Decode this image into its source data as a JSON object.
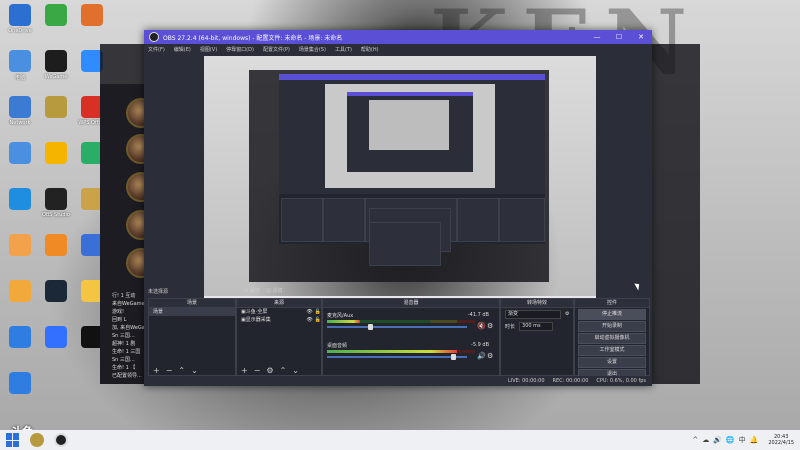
{
  "desktop": {
    "icons": [
      {
        "label": "OneDrive",
        "icon": "onedrive-icon",
        "color": "#2b6fd1"
      },
      {
        "label": "",
        "icon": "browser-icon",
        "color": "#3aa845"
      },
      {
        "label": "",
        "icon": "app-icon",
        "color": "#e2702d"
      },
      {
        "label": "电脑",
        "icon": "computer-icon",
        "color": "#4b8fe0"
      },
      {
        "label": "WeGame",
        "icon": "wegame-icon",
        "color": "#1d1d1d"
      },
      {
        "label": "",
        "icon": "baidu-netdisk-icon",
        "color": "#2f8cff"
      },
      {
        "label": "Network",
        "icon": "network-icon",
        "color": "#3b7bd4"
      },
      {
        "label": "",
        "icon": "lol-icon",
        "color": "#b89a3e"
      },
      {
        "label": "WPS Office",
        "icon": "wps-icon",
        "color": "#d93025"
      },
      {
        "label": "",
        "icon": "control-panel-icon",
        "color": "#4b8fe0"
      },
      {
        "label": "",
        "icon": "qq-music-icon",
        "color": "#f4b400"
      },
      {
        "label": "",
        "icon": "wechat-icon",
        "color": "#2aae67"
      },
      {
        "label": "",
        "icon": "edge-icon",
        "color": "#1f8de0"
      },
      {
        "label": "OBS Studio",
        "icon": "obs-icon",
        "color": "#222222"
      },
      {
        "label": "",
        "icon": "game-icon",
        "color": "#caa24a"
      },
      {
        "label": "",
        "icon": "downloader-icon",
        "color": "#f1a24a"
      },
      {
        "label": "",
        "icon": "edit-icon",
        "color": "#f08a24"
      },
      {
        "label": "",
        "icon": "kingsoft-icon",
        "color": "#3a6fd8"
      },
      {
        "label": "",
        "icon": "tool-icon",
        "color": "#f2a93b"
      },
      {
        "label": "",
        "icon": "steam-icon",
        "color": "#1b2838"
      },
      {
        "label": "",
        "icon": "folder-icon",
        "color": "#f4c542"
      },
      {
        "label": "",
        "icon": "store-icon",
        "color": "#2f7de1"
      },
      {
        "label": "",
        "icon": "feishu-icon",
        "color": "#3370ff"
      },
      {
        "label": "",
        "icon": "qq-icon",
        "color": "#111111"
      },
      {
        "label": "",
        "icon": "sync-icon",
        "color": "#2f7de1"
      }
    ],
    "watermark": "斗鱼"
  },
  "bg_app": {
    "chat_lines": [
      "行! 1 互动",
      "来自WeGame",
      "游戏!",
      "回到 L",
      "加, 来自WeGame",
      "Sn 三国...",
      "超神! 1 剧",
      "生命! 1 三国",
      "Sn 三国...",
      "生命! 1 【",
      "已配置领导..."
    ]
  },
  "obs": {
    "title": "OBS 27.2.4 (64-bit, windows) - 配置文件: 未命名 - 场景: 未命名",
    "menu": [
      "文件(F)",
      "编辑(E)",
      "视图(V)",
      "停靠窗口(D)",
      "配置文件(P)",
      "场景集合(S)",
      "工具(T)",
      "帮助(H)"
    ],
    "preview_taskbar": "",
    "dock_title": "未选择源",
    "dock_props": "属性",
    "dock_filters": "滤镜",
    "scenes": {
      "title": "场景",
      "items": [
        "场景"
      ]
    },
    "sources": {
      "title": "来源",
      "items": [
        "斗鱼·全屏",
        "显示器采集"
      ]
    },
    "mixer": {
      "title": "混音器",
      "channels": [
        {
          "name": "麦克风/Aux",
          "db": "-41.7 dB",
          "level": 0.22,
          "volume": 0.3,
          "muted": true
        },
        {
          "name": "桌面音频",
          "db": "-5.9 dB",
          "level": 0.88,
          "volume": 0.92,
          "muted": false
        }
      ]
    },
    "transitions": {
      "title": "转场特效",
      "type": "渐变",
      "duration_label": "时长",
      "duration": "300 ms"
    },
    "controls": {
      "title": "控件",
      "buttons": [
        "停止推流",
        "开始录制",
        "启动虚拟摄像机",
        "工作室模式",
        "设置",
        "退出"
      ]
    },
    "status": {
      "live": "LIVE: 00:00:00",
      "rec": "REC: 00:00:00",
      "cpu": "CPU: 0.6%, 0.00 fps"
    }
  },
  "taskbar": {
    "time": "20:43",
    "date": "2022/4/15",
    "tray": [
      "^",
      "☁",
      "🔊",
      "🌐",
      "中",
      "🔔"
    ]
  }
}
